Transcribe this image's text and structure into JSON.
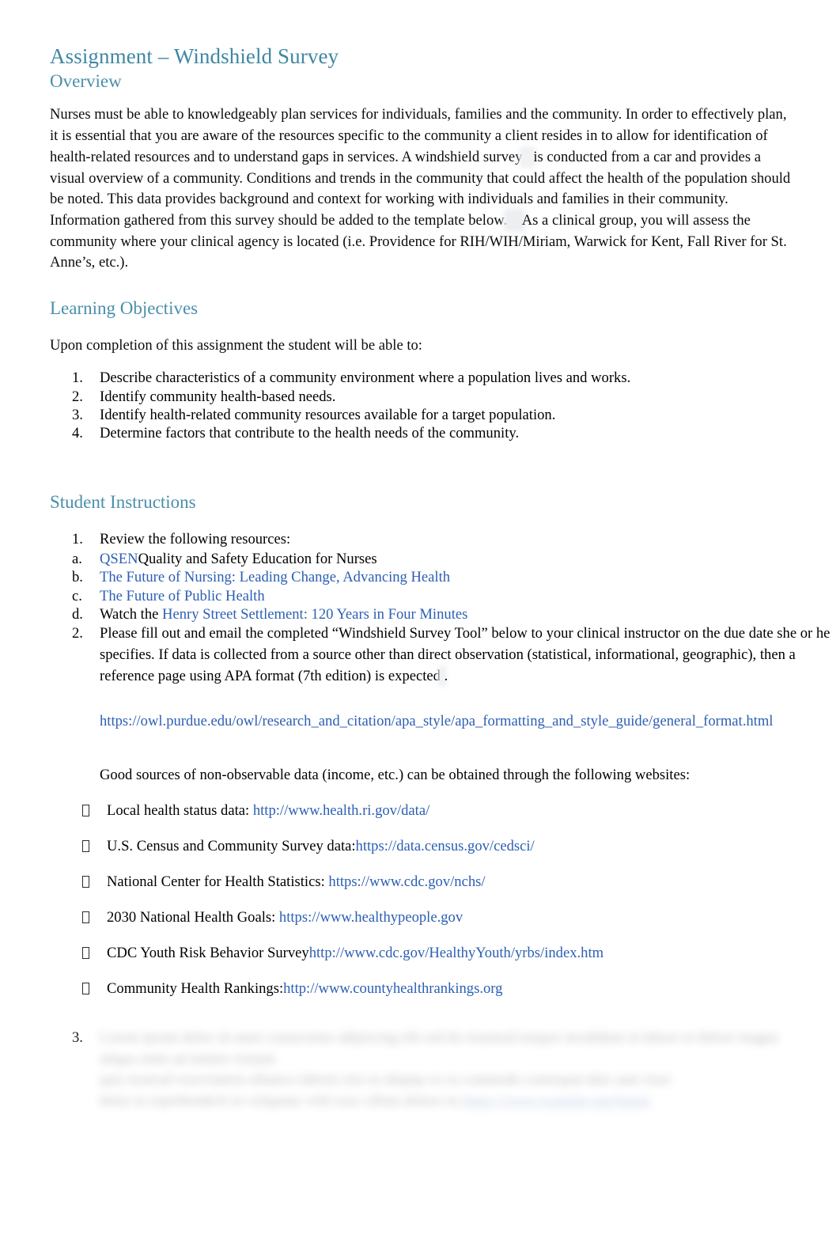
{
  "document": {
    "title": "Assignment – Windshield Survey",
    "subtitle": "Overview",
    "overview_paragraph": "Nurses must be able to knowledgeably plan services for individuals, families and the community.   In order to effectively plan, it is essential that you are aware of the resources specific to the community a client resides in to allow for identification of health-related resources and to understand gaps in services. A windshield survey",
    "overview_paragraph_2": "is conducted from a car and provides a visual overview of a community. Conditions and trends in the community that could affect the health of the population should be noted. This data provides background and context for working with individuals and families in their community.   Information gathered from this survey should be added to the template below.",
    "overview_paragraph_3": "As a clinical group, you will assess the community where your clinical agency is located (i.e. Providence for RIH/WIH/Miriam, Warwick for Kent, Fall River for St. Anne’s, etc.).",
    "shaded_phrase": " windshield survey "
  },
  "learning_objectives": {
    "heading": "Learning Objectives",
    "lead_in": "Upon completion of this assignment the student will be able to:",
    "items": [
      {
        "marker": "1.",
        "text": "Describe characteristics of a community environment where a population lives and works."
      },
      {
        "marker": "2.",
        "text": "Identify community health-based needs."
      },
      {
        "marker": "3.",
        "text": "Identify health-related community resources available for a target population."
      },
      {
        "marker": "4.",
        "text": "Determine factors that contribute to the health needs of the community."
      }
    ]
  },
  "student_instructions": {
    "heading": "Student Instructions",
    "item1": {
      "marker": "1.",
      "text": "Review the following resources:",
      "resources": [
        {
          "marker": "a.",
          "link_text": "QSEN",
          "trailing_text": "Quality and Safety Education for Nurses",
          "leading_text": ""
        },
        {
          "marker": "b.",
          "link_text": "The Future of Nursing: Leading Change, Advancing Health",
          "trailing_text": "",
          "leading_text": ""
        },
        {
          "marker": "c.",
          "link_text": "The Future of Public Health",
          "trailing_text": "",
          "leading_text": ""
        },
        {
          "marker": "d.",
          "link_text": "Henry Street Settlement: 120 Years in Four Minutes",
          "trailing_text": "",
          "leading_text": "Watch the "
        }
      ]
    },
    "item2": {
      "marker": "2.",
      "text_a": "Please fill out and email the completed “Windshield Survey Tool” below to your clinical instructor on the due date she or he specifies.   If data is collected from a source other than direct observation (statistical, informational, geographic), then a  reference page using APA format (7th edition) is expected",
      "text_b": ".",
      "apa_url": "https://owl.purdue.edu/owl/research_and_citation/apa_style/apa_formatting_and_style_guide/general_format.html",
      "sources_lead_in": "Good sources of non-observable data (income, etc.) can be obtained through the following websites:",
      "sources": [
        {
          "bullet": "tofu-box-bullet",
          "label": "Local health status data:  ",
          "url": "http://www.health.ri.gov/data/"
        },
        {
          "bullet": "tofu-box-bullet",
          "label": "U.S. Census and Community Survey data:",
          "url": "https://data.census.gov/cedsci/"
        },
        {
          "bullet": "tofu-box-bullet",
          "label": "National Center for Health Statistics: ",
          "url": "https://www.cdc.gov/nchs/"
        },
        {
          "bullet": "tofu-box-bullet",
          "label": "2030 National Health Goals:  ",
          "url": "https://www.healthypeople.gov"
        },
        {
          "bullet": "tofu-box-bullet",
          "label": "CDC Youth Risk Behavior Survey",
          "url": "http://www.cdc.gov/HealthyYouth/yrbs/index.htm"
        },
        {
          "bullet": "tofu-box-bullet",
          "label": "Community Health Rankings:",
          "url": "http://www.countyhealthrankings.org"
        }
      ]
    },
    "item3": {
      "marker": "3.",
      "redacted": true,
      "line1": "",
      "line2": "",
      "line3": ""
    }
  },
  "colors": {
    "heading_teal": "#4a8faa",
    "title_teal": "#3f87a2",
    "link_blue": "#2c5fb3",
    "body_text": "#0b0b0b",
    "page_background": "#ffffff",
    "shade_grey": "#f0f2f4"
  }
}
